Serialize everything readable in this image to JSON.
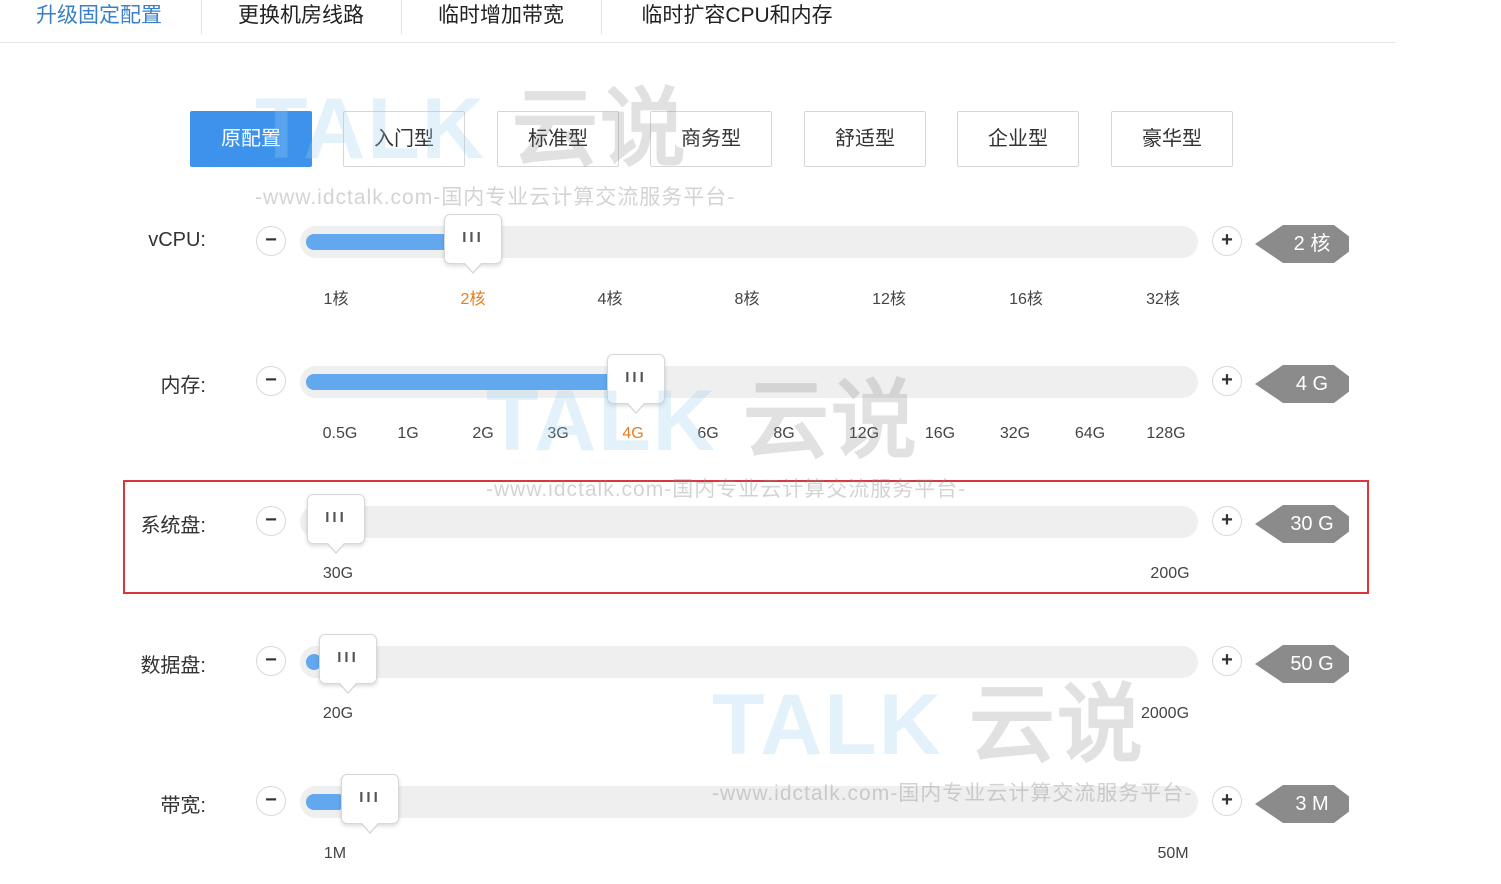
{
  "tabs": [
    "升级固定配置",
    "更换机房线路",
    "临时增加带宽",
    "临时扩容CPU和内存"
  ],
  "tiers": [
    "原配置",
    "入门型",
    "标准型",
    "商务型",
    "舒适型",
    "企业型",
    "豪华型"
  ],
  "watermark": {
    "brand": "TALK",
    "brand_cn": "云说",
    "url": "-www.idctalk.com-国内专业云计算交流服务平台-"
  },
  "thumb_grip": "III",
  "minus": "−",
  "plus": "+",
  "rows": [
    {
      "label": "vCPU:",
      "value": "2 核",
      "ticks": [
        "1核",
        "2核",
        "4核",
        "8核",
        "12核",
        "16核",
        "32核"
      ],
      "selected_tick": 1
    },
    {
      "label": "内存:",
      "value": "4 G",
      "ticks": [
        "0.5G",
        "1G",
        "2G",
        "3G",
        "4G",
        "6G",
        "8G",
        "12G",
        "16G",
        "32G",
        "64G",
        "128G"
      ],
      "selected_tick": 4
    },
    {
      "label": "系统盘:",
      "value": "30 G",
      "ticks": [
        "30G",
        "200G"
      ],
      "selected_tick": null
    },
    {
      "label": "数据盘:",
      "value": "50 G",
      "ticks": [
        "20G",
        "2000G"
      ],
      "selected_tick": null
    },
    {
      "label": "带宽:",
      "value": "3 M",
      "ticks": [
        "1M",
        "50M"
      ],
      "selected_tick": null
    }
  ],
  "colors": {
    "active_tab": "#3a80c8",
    "active_tier": "#3d93ec",
    "slider_fill": "#62a8ee",
    "selected_tick": "#e67e22",
    "value_badge": "#8b8b8b",
    "highlight_box": "#d9363e"
  }
}
